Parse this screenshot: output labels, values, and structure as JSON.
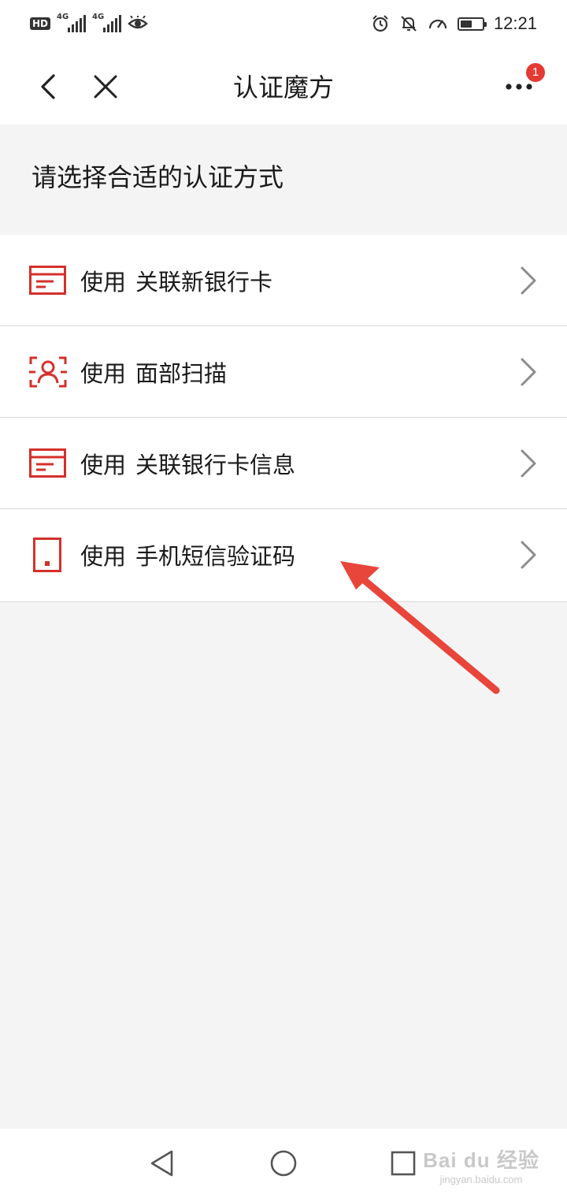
{
  "status_bar": {
    "hd_label": "HD",
    "sim1_tag": "4G",
    "sim2_tag": "4G",
    "time": "12:21",
    "battery_level": 0.55,
    "icons": [
      "eye-comfort-icon",
      "alarm-icon",
      "notifications-off-icon",
      "speed-icon",
      "battery-icon"
    ]
  },
  "nav": {
    "title": "认证魔方",
    "badge_count": "1",
    "icons": [
      "back-arrow-icon",
      "close-icon",
      "more-dots-icon"
    ]
  },
  "section_header": "请选择合适的认证方式",
  "methods": [
    {
      "prefix": "使用",
      "label": "关联新银行卡",
      "icon": "bank-card-icon"
    },
    {
      "prefix": "使用",
      "label": "面部扫描",
      "icon": "face-scan-icon"
    },
    {
      "prefix": "使用",
      "label": "关联银行卡信息",
      "icon": "bank-card-icon"
    },
    {
      "prefix": "使用",
      "label": "手机短信验证码",
      "icon": "phone-icon"
    }
  ],
  "colors": {
    "accent": "#d4302b",
    "arrow": "#e8463b",
    "badge": "#e53935",
    "background": "#f4f4f4"
  },
  "watermark": {
    "main": "Bai du 经验",
    "sub": "jingyan.baidu.com"
  }
}
